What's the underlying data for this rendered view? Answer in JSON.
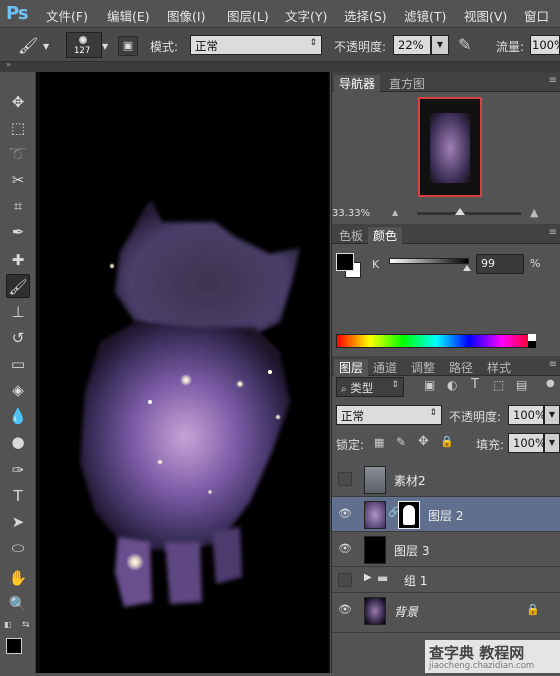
{
  "app": {
    "logo": "Ps"
  },
  "menu": [
    "文件(F)",
    "编辑(E)",
    "图像(I)",
    "图层(L)",
    "文字(Y)",
    "选择(S)",
    "滤镜(T)",
    "视图(V)",
    "窗口"
  ],
  "options": {
    "brush_size": "127",
    "mode_label": "模式:",
    "mode_value": "正常",
    "opacity_label": "不透明度:",
    "opacity_value": "22%",
    "flow_label": "流量:",
    "flow_value": "100%"
  },
  "navigator": {
    "tab1": "导航器",
    "tab2": "直方图",
    "zoom": "33.33%"
  },
  "color": {
    "tab1": "色板",
    "tab2": "颜色",
    "k_label": "K",
    "k_value": "99",
    "unit": "%",
    "k_level": 0.99
  },
  "layers": {
    "tabs": [
      "图层",
      "通道",
      "调整",
      "路径",
      "样式"
    ],
    "filter": "类型",
    "blend_mode": "正常",
    "opacity_label": "不透明度:",
    "opacity_value": "100%",
    "lock_label": "锁定:",
    "fill_label": "填充:",
    "fill_value": "100%",
    "items": [
      {
        "name": "素材2",
        "visible": false,
        "selected": false
      },
      {
        "name": "图层 2",
        "visible": true,
        "selected": true
      },
      {
        "name": "图层 3",
        "visible": true,
        "selected": false
      },
      {
        "name": "组 1",
        "visible": false,
        "selected": false
      },
      {
        "name": "背景",
        "visible": true,
        "selected": false
      }
    ]
  },
  "watermark": {
    "title": "查字典 教程网",
    "url": "jiaocheng.chazidian.com"
  }
}
